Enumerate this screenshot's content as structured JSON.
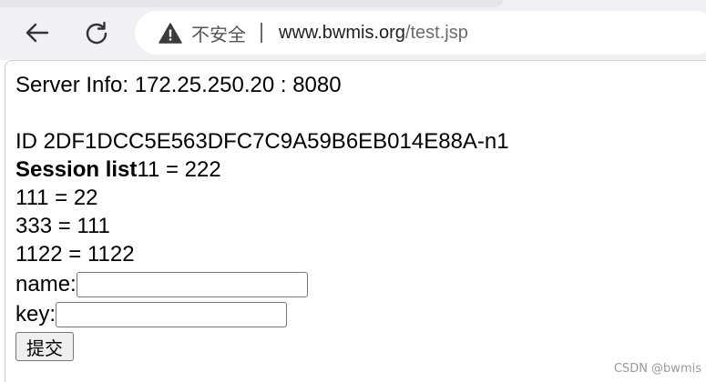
{
  "browser": {
    "security_label": "不安全",
    "url_host": "www.bwmis.org",
    "url_path": "/test.jsp"
  },
  "page": {
    "server_info": "Server Info: 172.25.250.20 : 8080",
    "session_id": "ID 2DF1DCC5E563DFC7C9A59B6EB014E88A-n1",
    "session_list_label": "Session list",
    "session_entries": [
      "11 = 222",
      "111 = 22",
      "333 = 111",
      "1122 = 1122"
    ]
  },
  "form": {
    "name_label": "name:",
    "name_value": "",
    "key_label": "key:",
    "key_value": "",
    "submit_label": "提交"
  },
  "watermark": "CSDN @bwmis",
  "colors": {
    "chrome_bg": "#eff1f4",
    "page_bg": "#ffffff",
    "url_path": "#6b6b6b"
  },
  "icons": {
    "back": "arrow-left-icon",
    "reload": "reload-icon",
    "security": "warning-triangle-icon"
  }
}
